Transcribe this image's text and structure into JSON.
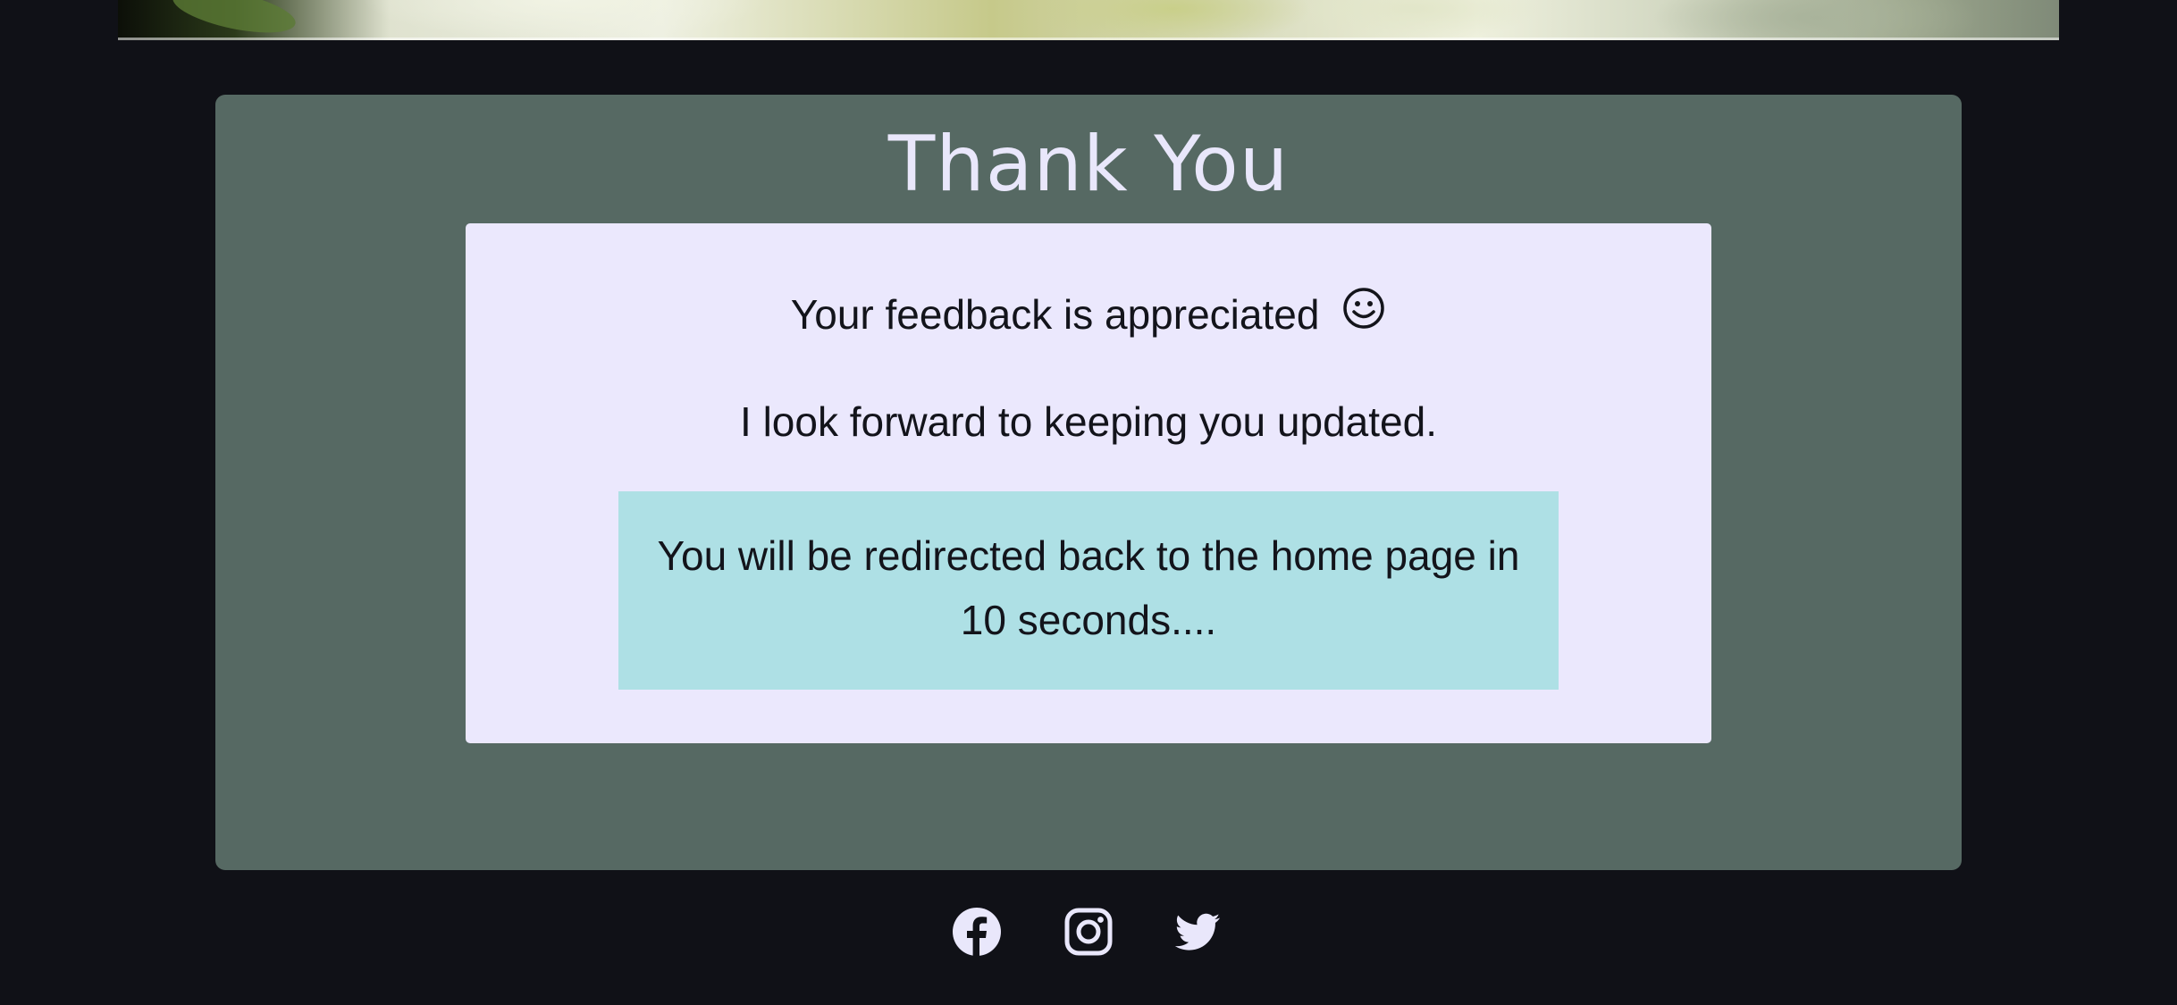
{
  "page": {
    "title": "Thank You",
    "feedback_line": "Your feedback is appreciated",
    "update_line": "I look forward to keeping you updated.",
    "redirect_message": "You will be redirected back to the home page in 10 seconds...."
  },
  "icons": {
    "smiley": "smiley-icon",
    "facebook": "facebook-icon",
    "instagram": "instagram-icon",
    "twitter": "twitter-icon"
  },
  "colors": {
    "background": "#101117",
    "card": "#566963",
    "inner_panel": "#ebe8fd",
    "redirect_box": "#aee0e5",
    "title_text": "#e9e7fb",
    "body_text": "#13141b",
    "icon_color": "#e9e7fb"
  }
}
